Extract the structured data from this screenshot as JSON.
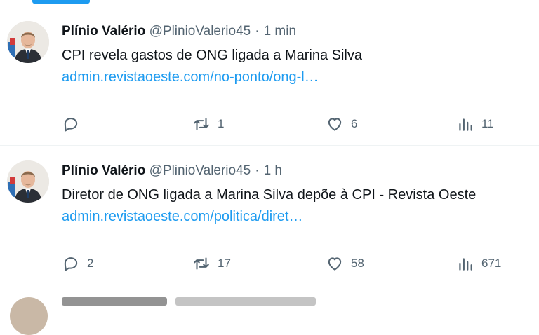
{
  "tweets": [
    {
      "name": "Plínio Valério",
      "handle": "@PlinioValerio45",
      "separator": "·",
      "time": "1 min",
      "text": "CPI revela gastos de ONG ligada a Marina Silva",
      "link": "admin.revistaoeste.com/no-ponto/ong-l…",
      "replies": "",
      "retweets": "1",
      "likes": "6",
      "views": "11"
    },
    {
      "name": "Plínio Valério",
      "handle": "@PlinioValerio45",
      "separator": "·",
      "time": "1 h",
      "text": "Diretor de ONG ligada a Marina Silva depõe à CPI - Revista Oeste",
      "link": "admin.revistaoeste.com/politica/diret…",
      "replies": "2",
      "retweets": "17",
      "likes": "58",
      "views": "671"
    }
  ],
  "icons": {
    "reply": "reply-icon",
    "retweet": "retweet-icon",
    "like": "heart-icon",
    "views": "views-icon"
  },
  "colors": {
    "accent": "#1d9bf0",
    "muted": "#536471",
    "text": "#0f1419"
  }
}
